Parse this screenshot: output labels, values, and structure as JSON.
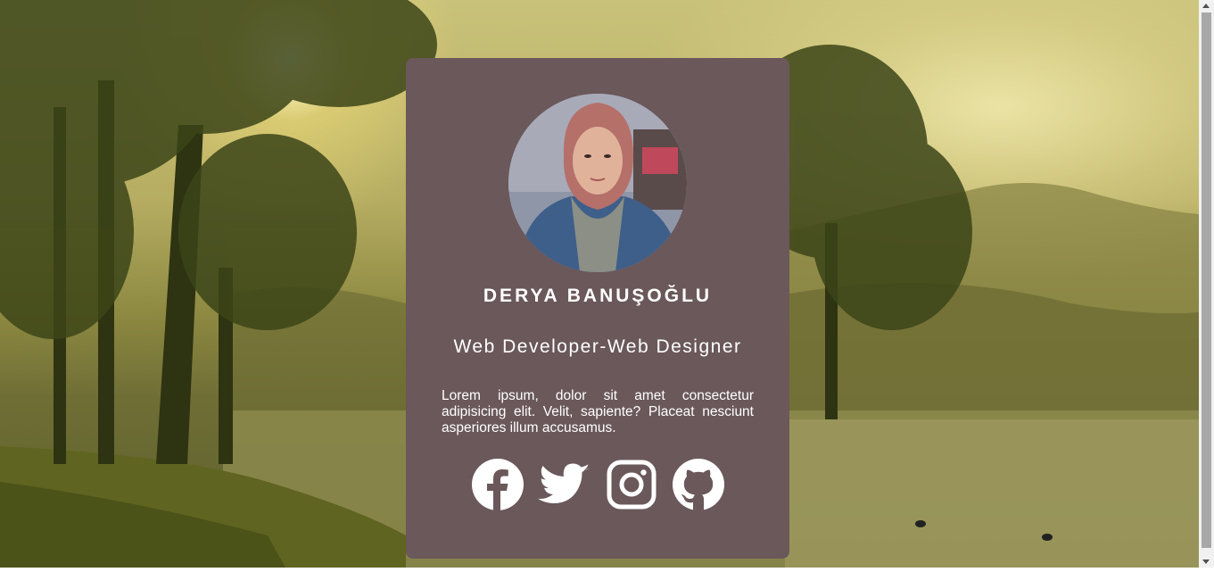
{
  "profile": {
    "name": "DERYA BANUŞOĞLU",
    "role": "Web Developer-Web Designer",
    "bio": "Lorem ipsum, dolor sit amet consectetur adipisicing elit. Velit, sapiente? Placeat nesciunt asperiores illum accusamus."
  },
  "socials": [
    {
      "icon": "facebook-icon"
    },
    {
      "icon": "twitter-icon"
    },
    {
      "icon": "instagram-icon"
    },
    {
      "icon": "github-icon"
    }
  ],
  "colors": {
    "card_background": "#6a585b",
    "text": "#ffffff"
  }
}
